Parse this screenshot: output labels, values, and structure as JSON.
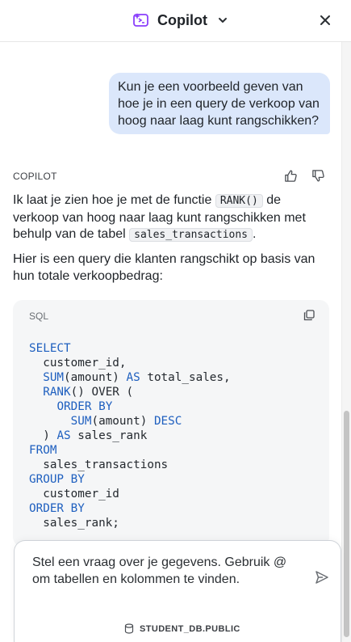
{
  "header": {
    "title": "Copilot",
    "logo_icon": "copilot-sparkle-icon",
    "dropdown_icon": "chevron-down-icon",
    "close_icon": "close-icon"
  },
  "conversation": {
    "user_message": "Kun je een voorbeeld geven van hoe je in een query de verkoop van hoog naar laag kunt rangschikken?",
    "assistant": {
      "label": "COPILOT",
      "feedback_icons": [
        "thumbs-up-icon",
        "thumbs-down-icon"
      ],
      "paragraph1": {
        "part1": "Ik laat je zien hoe je met de functie ",
        "code1": "RANK()",
        "part2": " de verkoop van hoog naar laag kunt rangschikken met behulp van de tabel ",
        "code2": "sales_transactions",
        "part3": "."
      },
      "paragraph2": "Hier is een query die klanten rangschikt op basis van hun totale verkoopbedrag:",
      "code_block": {
        "language": "SQL",
        "copy_icon": "copy-icon",
        "lines": [
          {
            "kw": "SELECT",
            "text": ""
          },
          {
            "indent": "  ",
            "text": "customer_id,"
          },
          {
            "indent": "  ",
            "fn": "SUM",
            "text": "(amount) ",
            "kw2": "AS",
            "text2": " total_sales,"
          },
          {
            "indent": "  ",
            "fn": "RANK",
            "text": "() OVER ("
          },
          {
            "indent": "    ",
            "kw": "ORDER BY",
            "text": ""
          },
          {
            "indent": "      ",
            "fn": "SUM",
            "text": "(amount) ",
            "kw2": "DESC",
            "text2": ""
          },
          {
            "indent": "  ",
            "text": ") ",
            "kw2": "AS",
            "text2": " sales_rank"
          },
          {
            "kw": "FROM",
            "text": ""
          },
          {
            "indent": "  ",
            "text": "sales_transactions"
          },
          {
            "kw": "GROUP BY",
            "text": ""
          },
          {
            "indent": "  ",
            "text": "customer_id"
          },
          {
            "kw": "ORDER BY",
            "text": ""
          },
          {
            "indent": "  ",
            "text": "sales_rank;"
          }
        ]
      }
    }
  },
  "input": {
    "placeholder": "Stel een vraag over je gegevens. Gebruik @ om tabellen en kolommen te vinden.",
    "send_icon": "send-icon",
    "database": "STUDENT_DB.PUBLIC",
    "database_icon": "database-icon"
  },
  "colors": {
    "user_bubble": "#dbe7fb",
    "code_bg": "#f5f6f7",
    "keyword": "#1e5fbf"
  }
}
